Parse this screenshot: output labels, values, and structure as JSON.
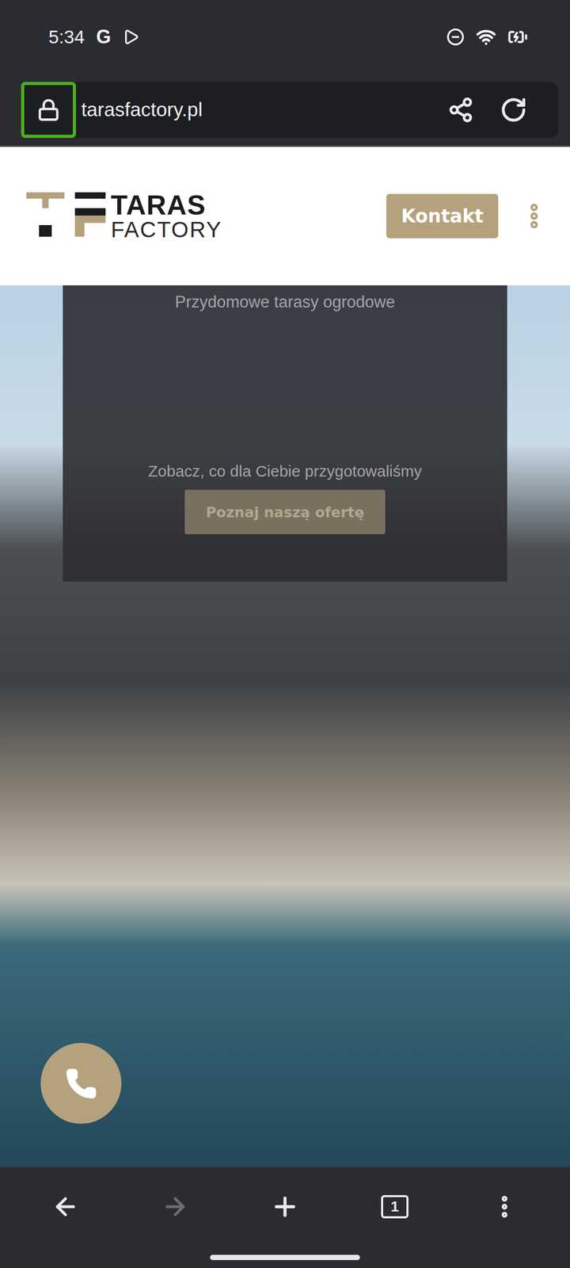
{
  "status_bar": {
    "time": "5:34",
    "app_badge": "G"
  },
  "browser": {
    "url": "tarasfactory.pl",
    "lock_highlighted": true,
    "back_enabled": true,
    "forward_enabled": false,
    "tab_count": "1"
  },
  "site": {
    "logo": {
      "line1": "TARAS",
      "line2": "FACTORY"
    },
    "contact_button": "Kontakt",
    "hero": {
      "subtitle": "Przydomowe tarasy ogrodowe",
      "tagline": "Zobacz, co dla Ciebie przygotowaliśmy",
      "cta": "Poznaj naszą ofertę"
    }
  }
}
